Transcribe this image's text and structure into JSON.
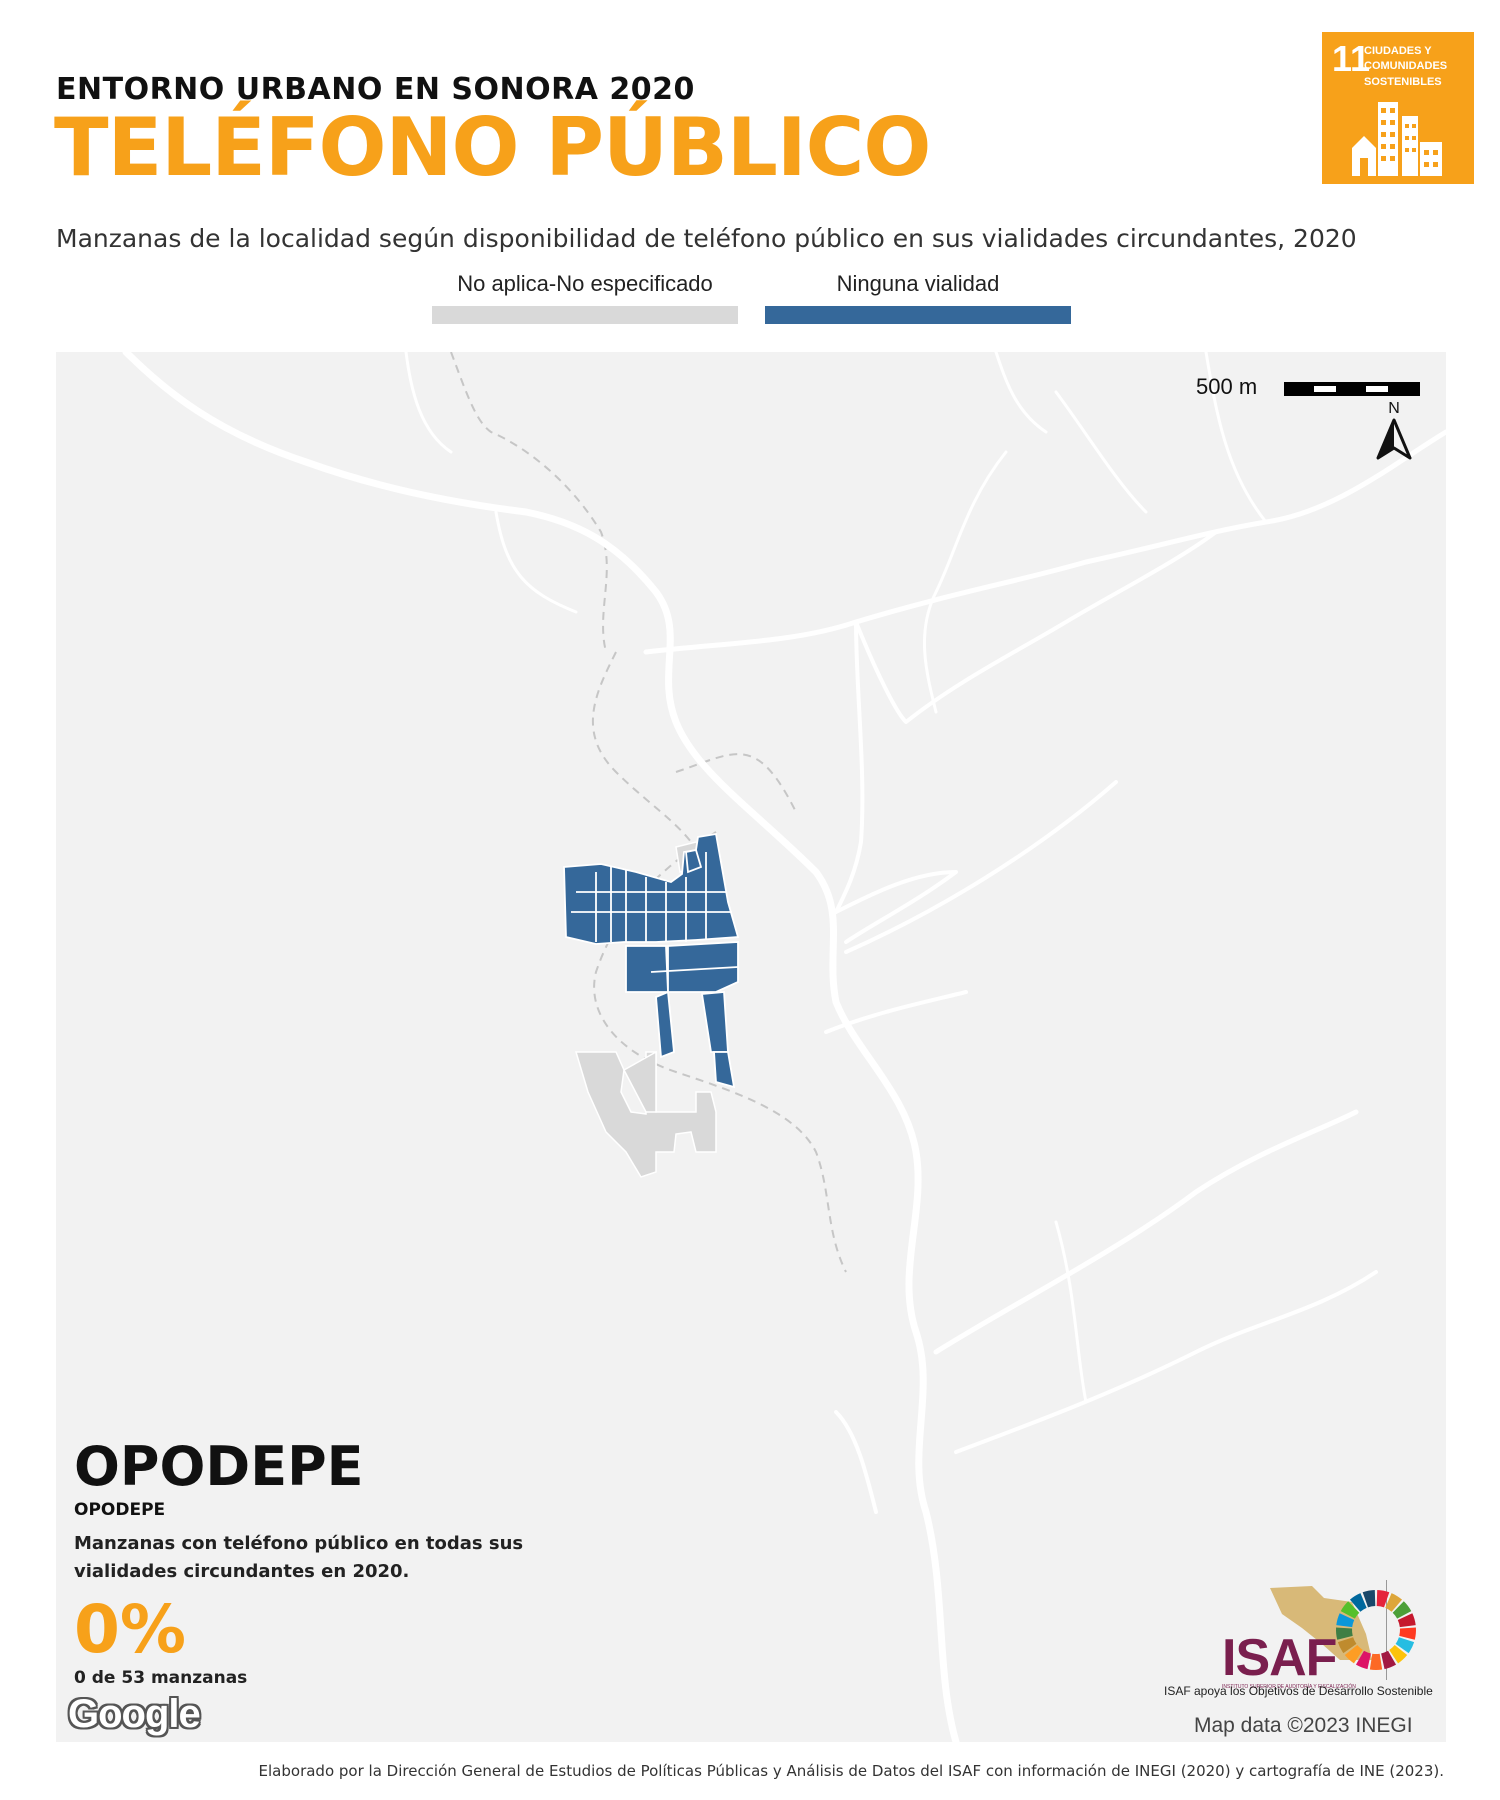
{
  "header": {
    "kicker": "ENTORNO URBANO EN SONORA 2020",
    "title": "TELÉFONO PÚBLICO",
    "subtitle": "Manzanas de la localidad según disponibilidad de teléfono público en sus vialidades circundantes, 2020"
  },
  "sdg_badge": {
    "number": "11",
    "text": "CIUDADES Y COMUNIDADES SOSTENIBLES",
    "color": "#f7a11a"
  },
  "legend": [
    {
      "label": "No aplica-No especificado",
      "color": "#d9d9d9"
    },
    {
      "label": "Ninguna vialidad",
      "color": "#35689a"
    }
  ],
  "map": {
    "scale_label": "500 m",
    "north_label": "N",
    "attribution": "Map data ©2023 INEGI",
    "provider": "Google",
    "colors": {
      "background": "#f2f2f2",
      "road": "#ffffff",
      "trail": "#c8c8c8",
      "blocks_none": "#35689a",
      "blocks_na": "#d9d9d9"
    }
  },
  "info": {
    "place_big": "OPODEPE",
    "place_small": "OPODEPE",
    "description": "Manzanas con teléfono público en todas sus vialidades circundantes en 2020.",
    "percent": "0%",
    "count": "0 de 53 manzanas"
  },
  "logos": {
    "isaf": "ISAF",
    "isaf_sub": "INSTITUTO SUPERIOR DE AUDITORÍA Y FISCALIZACIÓN",
    "sdg_caption": "ISAF apoya los Objetivos de Desarrollo Sostenible"
  },
  "footer": "Elaborado por la Dirección General de Estudios de Políticas Públicas y Análisis de Datos del ISAF con información de INEGI (2020) y cartografía de INE (2023)."
}
